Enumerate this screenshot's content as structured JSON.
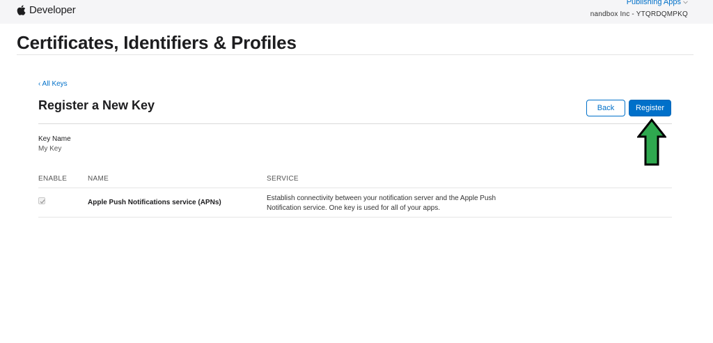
{
  "header": {
    "brand_label": "Developer",
    "menu_label": "Publishing Apps",
    "team_name": "nandbox Inc - YTQRDQMPKQ"
  },
  "page": {
    "title": "Certificates, Identifiers & Profiles"
  },
  "form": {
    "back_link": "‹ All Keys",
    "section_title": "Register a New Key",
    "back_button": "Back",
    "register_button": "Register",
    "key_name_label": "Key Name",
    "key_name_value": "My Key"
  },
  "table": {
    "headers": [
      "ENABLE",
      "NAME",
      "SERVICE"
    ],
    "rows": [
      {
        "enabled": true,
        "name": "Apple Push Notifications service (APNs)",
        "service": "Establish connectivity between your notification server and the Apple Push Notification service. One key is used for all of your apps."
      }
    ]
  },
  "colors": {
    "accent": "#0070c9",
    "annotation_arrow": "#2fa84f"
  }
}
